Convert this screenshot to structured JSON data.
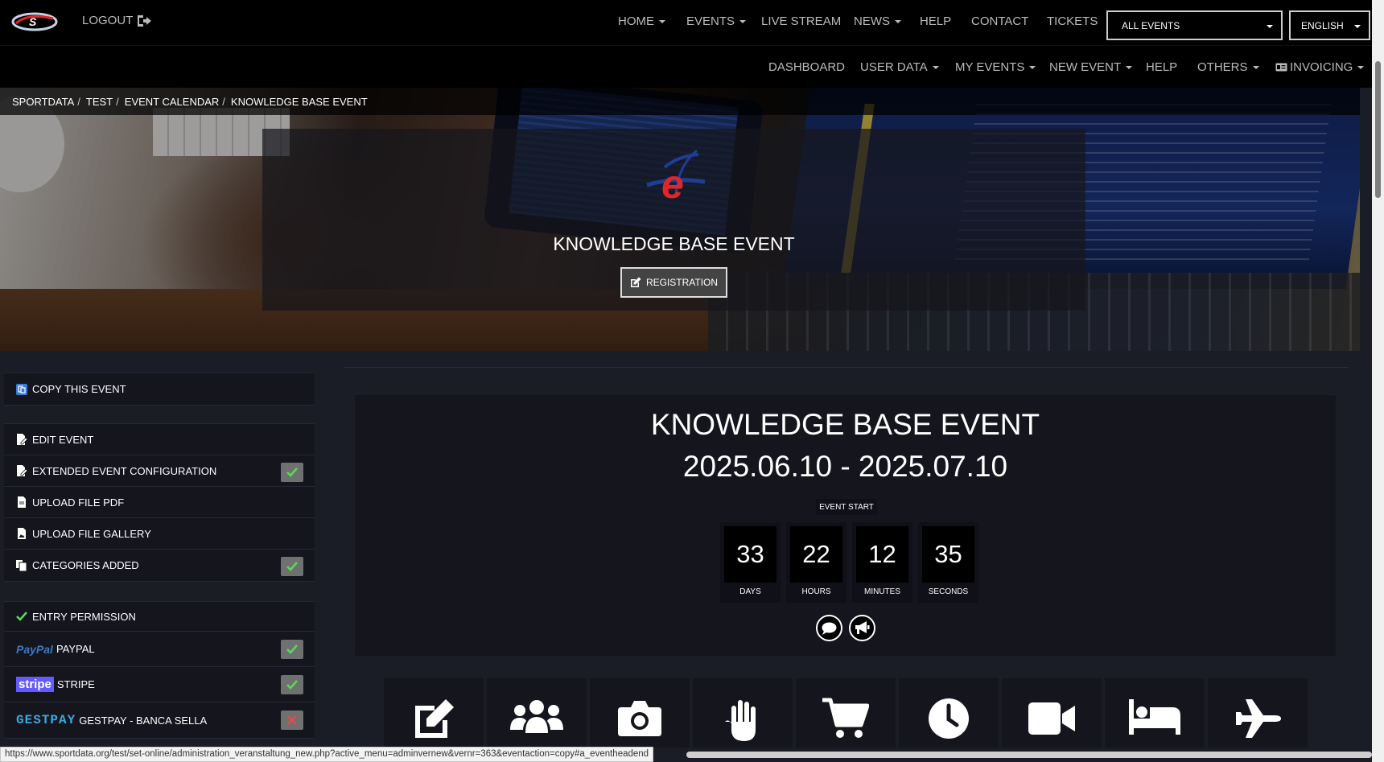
{
  "topbar": {
    "logout_label": "LOGOUT",
    "nav": [
      "HOME",
      "EVENTS",
      "LIVE STREAM",
      "NEWS",
      "HELP",
      "CONTACT",
      "TICKETS"
    ],
    "events_select": "ALL EVENTS",
    "language_select": "ENGLISH"
  },
  "subbar": {
    "nav": [
      "DASHBOARD",
      "USER DATA",
      "MY EVENTS",
      "NEW EVENT",
      "HELP",
      "OTHERS",
      "INVOICING"
    ]
  },
  "breadcrumb": [
    "SPORTDATA",
    "TEST",
    "EVENT CALENDAR",
    "KNOWLEDGE BASE EVENT"
  ],
  "hero": {
    "title": "KNOWLEDGE BASE EVENT",
    "registration_label": "REGISTRATION"
  },
  "sidebar": {
    "copy_event": "COPY THIS EVENT",
    "edit_group": [
      {
        "label": "EDIT EVENT",
        "status": null
      },
      {
        "label": "EXTENDED EVENT CONFIGURATION",
        "status": "ok"
      },
      {
        "label": "UPLOAD FILE PDF",
        "status": null
      },
      {
        "label": "UPLOAD FILE GALLERY",
        "status": null
      },
      {
        "label": "CATEGORIES ADDED",
        "status": "ok"
      }
    ],
    "payment_group": [
      {
        "label": "ENTRY PERMISSION",
        "status": null
      },
      {
        "label": "PAYPAL",
        "brand": "PayPal",
        "status": "ok"
      },
      {
        "label": "STRIPE",
        "brand": "stripe",
        "status": "ok"
      },
      {
        "label": "GESTPAY - BANCA SELLA",
        "brand": "GESTPAY",
        "status": "no"
      }
    ]
  },
  "event": {
    "title": "KNOWLEDGE BASE EVENT",
    "dates": "2025.06.10 - 2025.07.10",
    "start_label": "EVENT START",
    "countdown": [
      {
        "value": "33",
        "label": "DAYS"
      },
      {
        "value": "22",
        "label": "HOURS"
      },
      {
        "value": "12",
        "label": "MINUTES"
      },
      {
        "value": "35",
        "label": "SECONDS"
      }
    ]
  },
  "tiles": [
    "edit-icon",
    "users-icon",
    "camera-icon",
    "hand-icon",
    "cart-icon",
    "clock-icon",
    "video-icon",
    "bed-icon",
    "plane-icon"
  ],
  "statusbar": {
    "url": "https://www.sportdata.org/test/set-online/administration_veranstaltung_new.php?active_menu=adminvernew&vernr=363&eventaction=copy#a_eventheadend"
  },
  "colors": {
    "background": "#1b1d26",
    "panel": "#14151d",
    "check_ok": "#5cd65c",
    "check_no": "#e8474c",
    "brand_red": "#e0262b",
    "brand_blue": "#1c3f94"
  }
}
